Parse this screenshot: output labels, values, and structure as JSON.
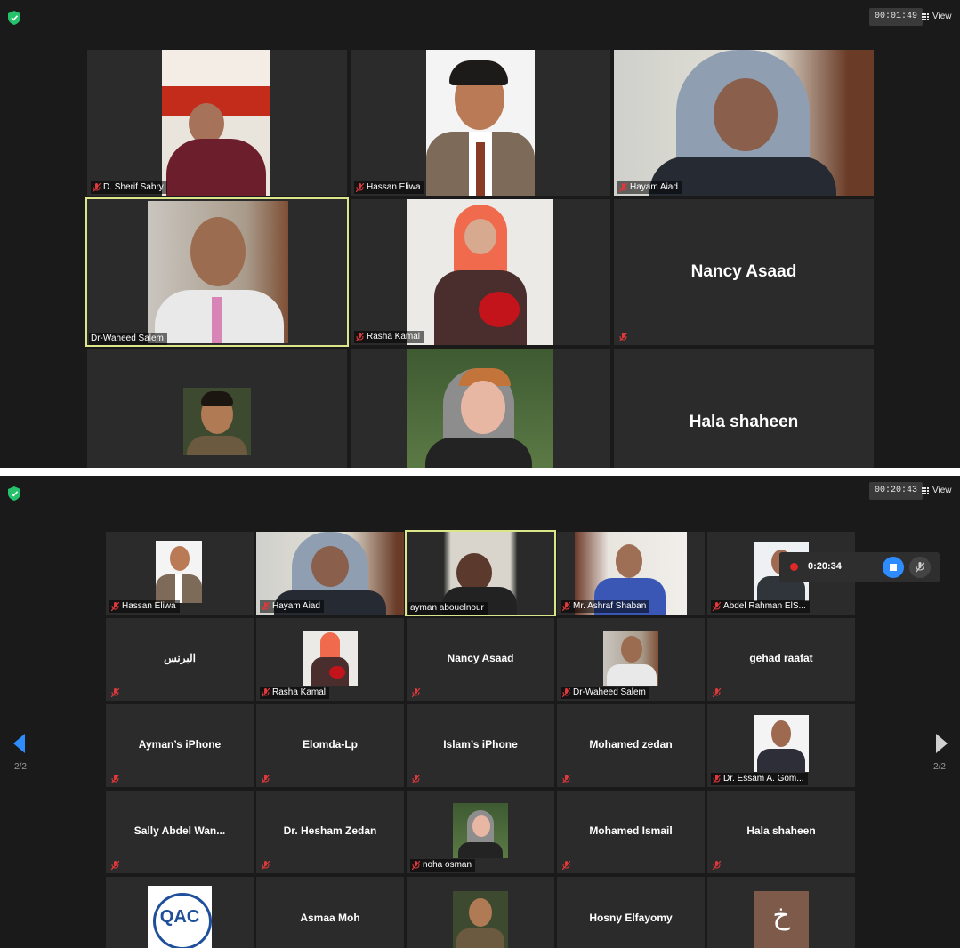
{
  "panel1": {
    "timer": "00:01:49",
    "view_label": "View",
    "tiles": [
      {
        "name": "D. Sherif Sabry"
      },
      {
        "name": "Hassan Eliwa"
      },
      {
        "name": "Hayam Aiad"
      },
      {
        "name": "Dr-Waheed Salem"
      },
      {
        "name": "Rasha Kamal"
      },
      {
        "name": "Nancy Asaad"
      },
      {
        "name": "Hala shaheen"
      }
    ]
  },
  "panel2": {
    "timer": "00:20:43",
    "view_label": "View",
    "recording_time": "0:20:34",
    "page_left": "2/2",
    "page_right": "2/2",
    "tiles": [
      {
        "name": "Hassan Eliwa"
      },
      {
        "name": "Hayam Aiad"
      },
      {
        "name": "ayman abouelnour"
      },
      {
        "name": "Mr. Ashraf Shaban"
      },
      {
        "name": "Abdel Rahman ElS..."
      },
      {
        "name": "البرنس"
      },
      {
        "name": "Rasha Kamal"
      },
      {
        "name": "Nancy Asaad"
      },
      {
        "name": "Dr-Waheed Salem"
      },
      {
        "name": "gehad raafat"
      },
      {
        "name": "Ayman’s iPhone"
      },
      {
        "name": "Elomda-Lp"
      },
      {
        "name": "Islam’s iPhone"
      },
      {
        "name": "Mohamed zedan"
      },
      {
        "name": "Dr. Essam A. Gom..."
      },
      {
        "name": "Sally  Abdel  Wan..."
      },
      {
        "name": "Dr. Hesham Zedan"
      },
      {
        "name": "noha osman"
      },
      {
        "name": "Mohamed Ismail"
      },
      {
        "name": "Hala shaheen"
      },
      {
        "name": "Asmaa Moh"
      },
      {
        "name": "Hosny Elfayomy"
      }
    ],
    "logo_text": "QAC",
    "avatar_letter": "خ"
  },
  "colors": {
    "background": "#1a1a1a",
    "tile": "#2b2b2b",
    "active_border": "#dbe68a",
    "muted_icon": "#e0383b",
    "accent_blue": "#2d8cff",
    "shield_green": "#25c26b"
  }
}
